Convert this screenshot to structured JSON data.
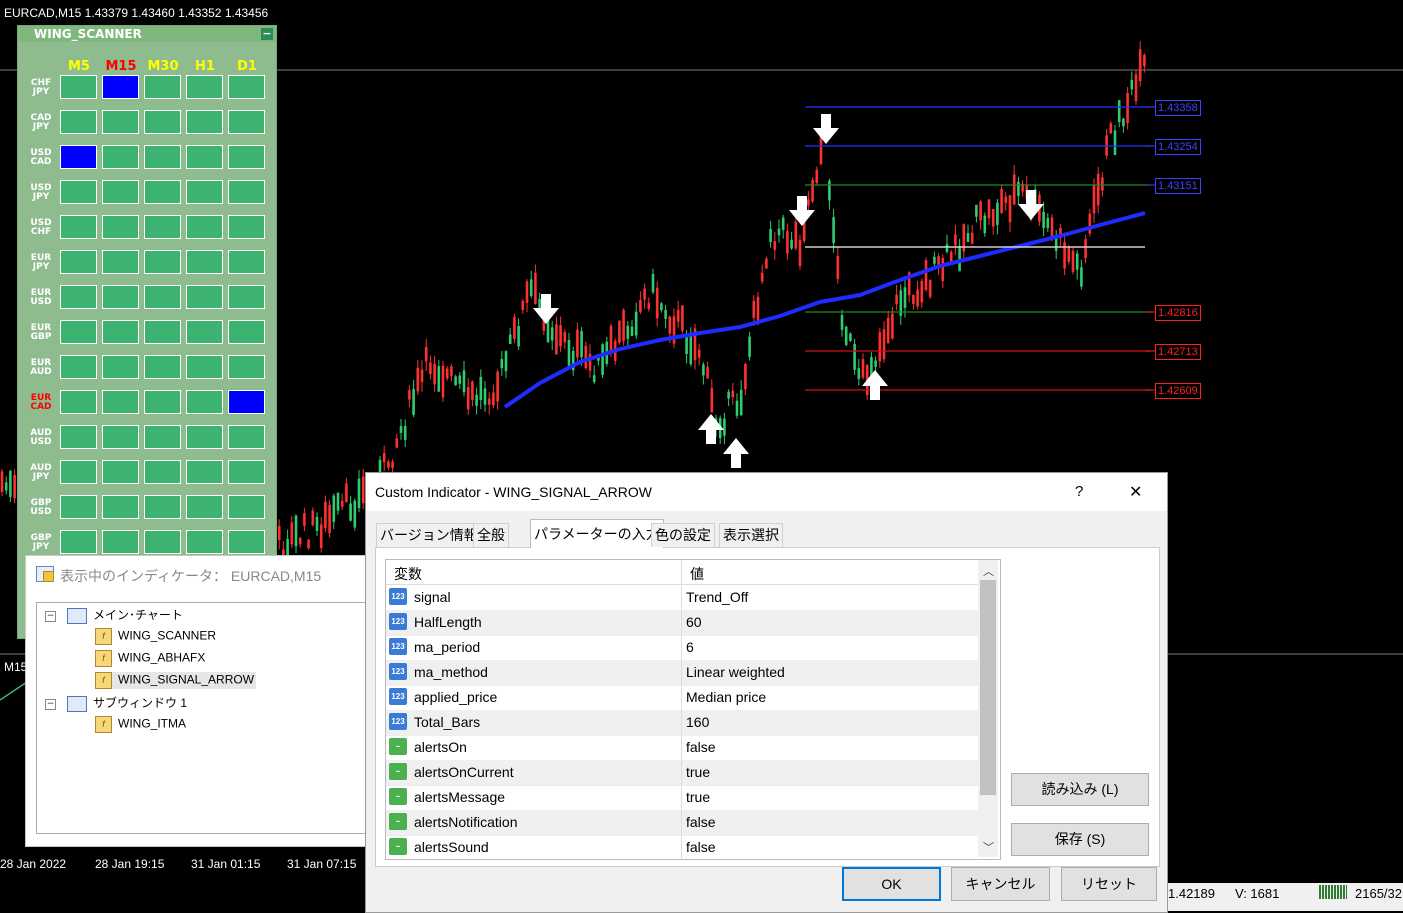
{
  "chart": {
    "title": "EURCAD,M15  1.43379 1.43460 1.43352 1.43456",
    "price_levels": [
      {
        "label": "1.43358",
        "color": "#4040ff"
      },
      {
        "label": "1.43254",
        "color": "#4040ff"
      },
      {
        "label": "1.43151",
        "color": "#4040ff"
      },
      {
        "label": "1.42816",
        "color": "#ff2020"
      },
      {
        "label": "1.42713",
        "color": "#ff2020"
      },
      {
        "label": "1.42609",
        "color": "#ff2020"
      }
    ],
    "time_labels": [
      "28 Jan 2022",
      "28 Jan 19:15",
      "31 Jan 01:15",
      "31 Jan 07:15"
    ],
    "subwindow_label": "M15",
    "status": {
      "price": "1.42189",
      "volume": "V: 1681",
      "bars": "2165/32"
    }
  },
  "scanner": {
    "title": "WING_SCANNER",
    "minimize": "−",
    "timeframes": [
      {
        "label": "M5",
        "color": "#ffff00"
      },
      {
        "label": "M15",
        "color": "#ff0000"
      },
      {
        "label": "M30",
        "color": "#ffff00"
      },
      {
        "label": "H1",
        "color": "#ffff00"
      },
      {
        "label": "D1",
        "color": "#ffff00"
      }
    ],
    "pairs": [
      {
        "top": "CHF",
        "bottom": "JPY",
        "highlight": false,
        "cells": [
          "g",
          "b",
          "g",
          "g",
          "g"
        ]
      },
      {
        "top": "CAD",
        "bottom": "JPY",
        "highlight": false,
        "cells": [
          "g",
          "g",
          "g",
          "g",
          "g"
        ]
      },
      {
        "top": "USD",
        "bottom": "CAD",
        "highlight": false,
        "cells": [
          "b",
          "g",
          "g",
          "g",
          "g"
        ]
      },
      {
        "top": "USD",
        "bottom": "JPY",
        "highlight": false,
        "cells": [
          "g",
          "g",
          "g",
          "g",
          "g"
        ]
      },
      {
        "top": "USD",
        "bottom": "CHF",
        "highlight": false,
        "cells": [
          "g",
          "g",
          "g",
          "g",
          "g"
        ]
      },
      {
        "top": "EUR",
        "bottom": "JPY",
        "highlight": false,
        "cells": [
          "g",
          "g",
          "g",
          "g",
          "g"
        ]
      },
      {
        "top": "EUR",
        "bottom": "USD",
        "highlight": false,
        "cells": [
          "g",
          "g",
          "g",
          "g",
          "g"
        ]
      },
      {
        "top": "EUR",
        "bottom": "GBP",
        "highlight": false,
        "cells": [
          "g",
          "g",
          "g",
          "g",
          "g"
        ]
      },
      {
        "top": "EUR",
        "bottom": "AUD",
        "highlight": false,
        "cells": [
          "g",
          "g",
          "g",
          "g",
          "g"
        ]
      },
      {
        "top": "EUR",
        "bottom": "CAD",
        "highlight": true,
        "cells": [
          "g",
          "g",
          "g",
          "g",
          "b"
        ]
      },
      {
        "top": "AUD",
        "bottom": "USD",
        "highlight": false,
        "cells": [
          "g",
          "g",
          "g",
          "g",
          "g"
        ]
      },
      {
        "top": "AUD",
        "bottom": "JPY",
        "highlight": false,
        "cells": [
          "g",
          "g",
          "g",
          "g",
          "g"
        ]
      },
      {
        "top": "GBP",
        "bottom": "USD",
        "highlight": false,
        "cells": [
          "g",
          "g",
          "g",
          "g",
          "g"
        ]
      },
      {
        "top": "GBP",
        "bottom": "JPY",
        "highlight": false,
        "cells": [
          "g",
          "g",
          "g",
          "g",
          "g"
        ]
      }
    ],
    "colors": {
      "green": "#3cb371",
      "blue": "#0000ff"
    }
  },
  "indicator_window": {
    "title": "表示中のインディケータ： EURCAD,M15",
    "main_chart": "メイン･チャート",
    "main_items": [
      "WING_SCANNER",
      "WING_ABHAFX",
      "WING_SIGNAL_ARROW"
    ],
    "subwindow": "サブウィンドウ 1",
    "sub_items": [
      "WING_ITMA"
    ]
  },
  "dialog": {
    "title": "Custom Indicator - WING_SIGNAL_ARROW",
    "help": "?",
    "close": "✕",
    "tabs": [
      "バージョン情報",
      "全般",
      "パラメーターの入力",
      "色の設定",
      "表示選択"
    ],
    "active_tab": 2,
    "columns": {
      "name": "変数",
      "value": "値"
    },
    "params": [
      {
        "name": "signal",
        "value": "Trend_Off",
        "type": "num"
      },
      {
        "name": "HalfLength",
        "value": "60",
        "type": "num"
      },
      {
        "name": "ma_period",
        "value": "6",
        "type": "num"
      },
      {
        "name": "ma_method",
        "value": "Linear weighted",
        "type": "num"
      },
      {
        "name": "applied_price",
        "value": "Median price",
        "type": "num"
      },
      {
        "name": "Total_Bars",
        "value": "160",
        "type": "num"
      },
      {
        "name": "alertsOn",
        "value": "false",
        "type": "bool"
      },
      {
        "name": "alertsOnCurrent",
        "value": "true",
        "type": "bool"
      },
      {
        "name": "alertsMessage",
        "value": "true",
        "type": "bool"
      },
      {
        "name": "alertsNotification",
        "value": "false",
        "type": "bool"
      },
      {
        "name": "alertsSound",
        "value": "false",
        "type": "bool"
      }
    ],
    "icon_labels": {
      "num": "123",
      "bool": "~"
    },
    "buttons": {
      "load": "読み込み (L)",
      "save": "保存 (S)",
      "ok": "OK",
      "cancel": "キャンセル",
      "reset": "リセット"
    }
  }
}
